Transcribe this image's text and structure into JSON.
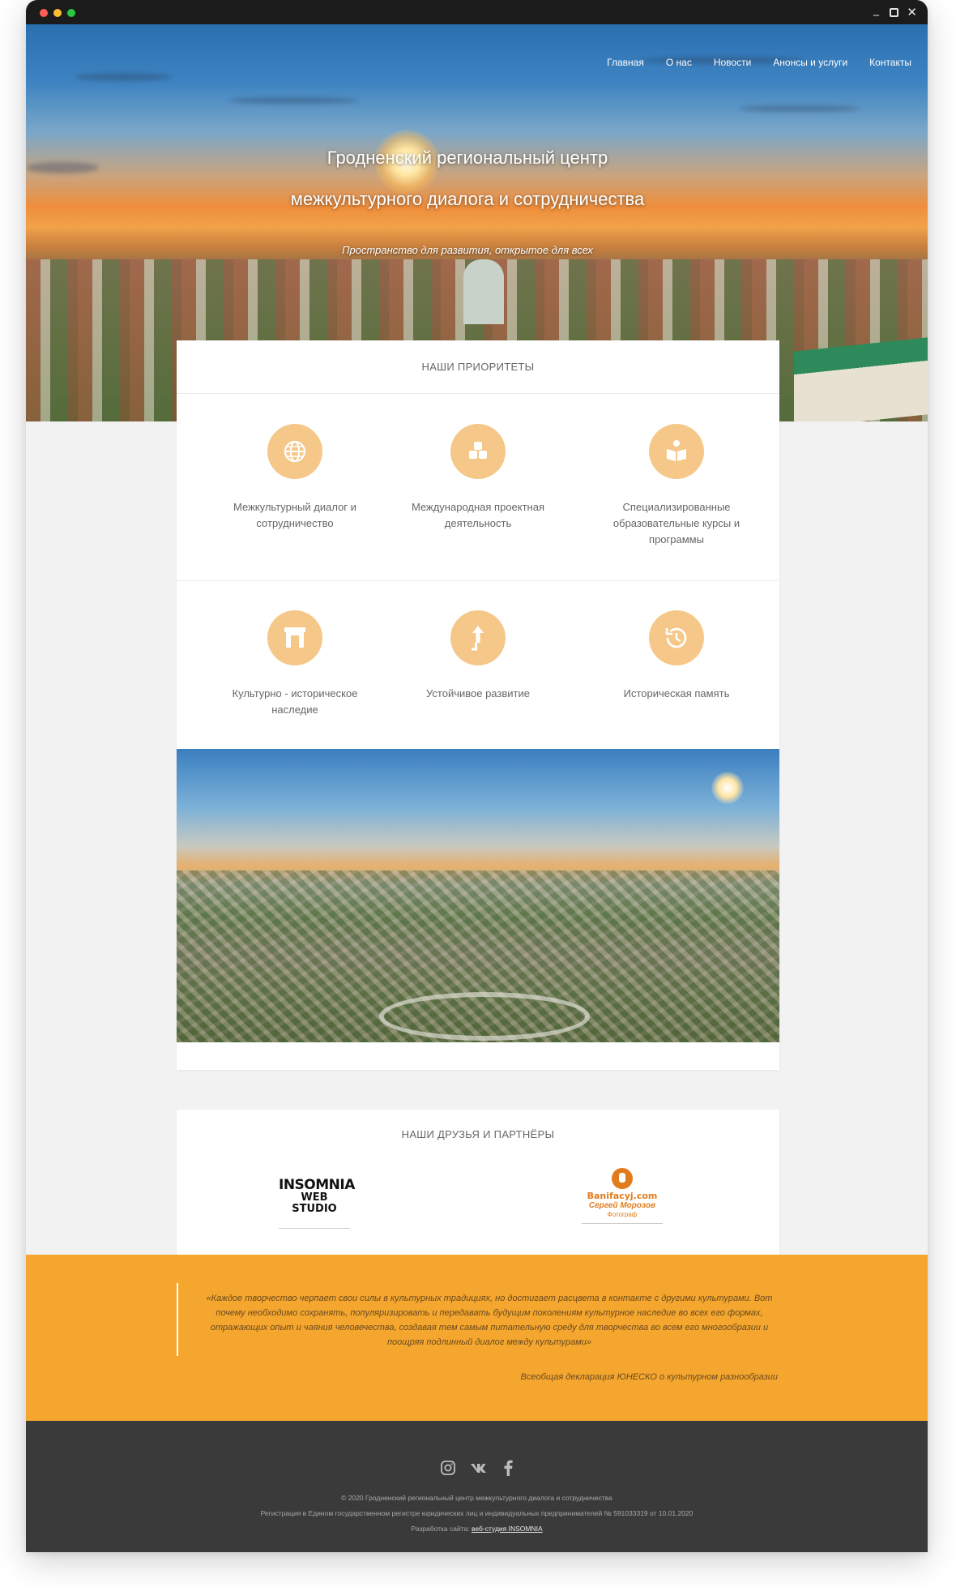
{
  "nav": {
    "items": [
      "Главная",
      "О нас",
      "Новости",
      "Анонсы и услуги",
      "Контакты"
    ]
  },
  "hero": {
    "title_line1": "Гродненский региональный центр",
    "title_line2": "межкультурного диалога и сотрудничества",
    "subtitle": "Пространство для развития, открытое для всех"
  },
  "priorities": {
    "heading": "НАШИ ПРИОРИТЕТЫ",
    "items": [
      {
        "label": "Межкультурный диалог и сотрудничество",
        "icon": "globe-icon"
      },
      {
        "label": "Международная проектная деятельность",
        "icon": "cubes-icon"
      },
      {
        "label": "Специализированные образовательные курсы и программы",
        "icon": "open-book-icon"
      },
      {
        "label": "Культурно - историческое наследие",
        "icon": "arch-icon"
      },
      {
        "label": "Устойчивое развитие",
        "icon": "arrow-up-icon"
      },
      {
        "label": "Историческая память",
        "icon": "history-icon"
      }
    ]
  },
  "partners": {
    "heading": "НАШИ ДРУЗЬЯ И ПАРТНЁРЫ",
    "insomnia_line1": "INSOMNIA",
    "insomnia_line2": "WEB STUDIO",
    "bani_name": "Banifacyj.com",
    "bani_author": "Сергей Морозов",
    "bani_role": "Фотограф"
  },
  "quote": {
    "text": "«Каждое творчество черпает свои силы в культурных традициях, но достигает расцвета в контакте с другими культурами. Вот почему необходимо сохранять, популяризировать и передавать будущим поколениям культурное наследие во всех его формах, отражающих опыт и чаяния человечества, создавая тем самым питательную среду для творчества во всем его многообразии и поощряя подлинный диалог между культурами»",
    "source": "Всеобщая декларация ЮНЕСКО о культурном разнообразии"
  },
  "footer": {
    "copyright": "© 2020 Гродненский региональный центр межкультурного диалога и сотрудничества",
    "registration": "Регистрация в Едином государственном регистре юридических лиц и индивидуальных предпринимателей № 591033319 от 10.01.2020",
    "dev_prefix": "Разработка сайта:",
    "dev_link": "веб-студия INSOMNIA",
    "socials": [
      "instagram-icon",
      "vk-icon",
      "facebook-icon"
    ]
  },
  "colors": {
    "accent": "#f4a62f",
    "icon_circle": "#f5c88a",
    "footer_bg": "#3a3a3a"
  }
}
